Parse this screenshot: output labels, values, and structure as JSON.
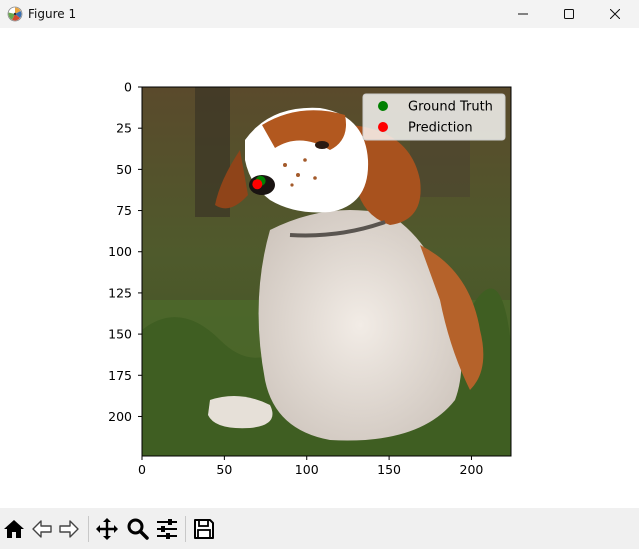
{
  "window": {
    "title": "Figure 1"
  },
  "chart_data": {
    "type": "scatter",
    "title": "",
    "xlabel": "",
    "ylabel": "",
    "xlim": [
      0,
      224
    ],
    "ylim": [
      224,
      0
    ],
    "xticks": [
      0,
      50,
      100,
      150,
      200
    ],
    "yticks": [
      0,
      25,
      50,
      75,
      100,
      125,
      150,
      175,
      200
    ],
    "grid": false,
    "legend_position": "top-right",
    "background_image": "photo of a brown-and-white spaniel dog sitting in grass",
    "series": [
      {
        "name": "Ground Truth",
        "color": "#008000",
        "x": [
          72
        ],
        "y": [
          57
        ]
      },
      {
        "name": "Prediction",
        "color": "#ff0000",
        "x": [
          70
        ],
        "y": [
          59
        ]
      }
    ]
  },
  "toolbar": {
    "icons": [
      "home-icon",
      "back-icon",
      "forward-icon",
      "pan-icon",
      "zoom-icon",
      "configure-subplots-icon",
      "save-icon"
    ]
  }
}
